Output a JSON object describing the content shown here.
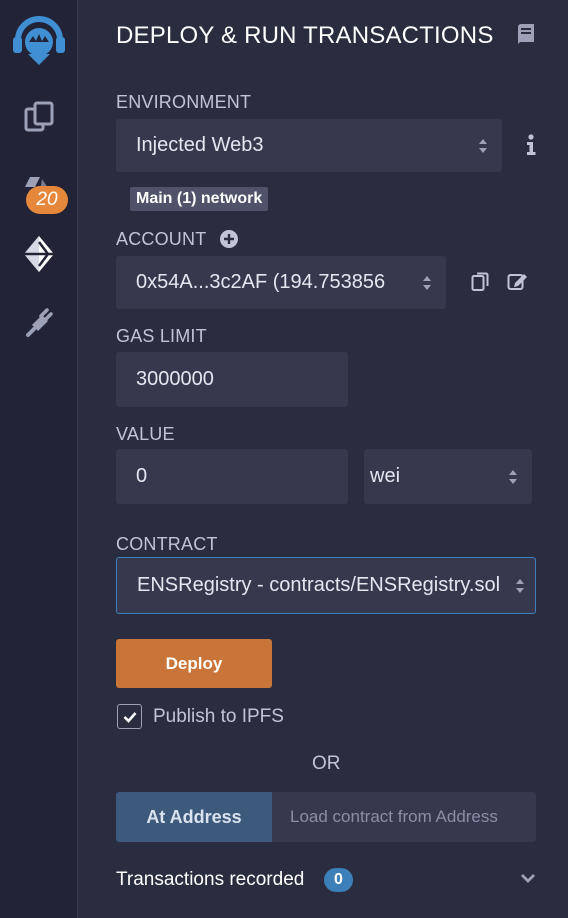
{
  "sidebar": {
    "icons": [
      "remix-logo-icon",
      "files-icon",
      "solidity-compiler-icon",
      "deploy-run-icon",
      "plugin-manager-icon"
    ],
    "compiler_badge": "20"
  },
  "header": {
    "title": "DEPLOY & RUN TRANSACTIONS"
  },
  "environment": {
    "label": "ENVIRONMENT",
    "selected": "Injected Web3",
    "network_tag": "Main (1) network"
  },
  "account": {
    "label": "ACCOUNT",
    "selected": "0x54A...3c2AF (194.753856"
  },
  "gas_limit": {
    "label": "GAS LIMIT",
    "value": "3000000"
  },
  "value": {
    "label": "VALUE",
    "amount": "0",
    "unit": "wei"
  },
  "contract": {
    "label": "CONTRACT",
    "selected": "ENSRegistry - contracts/ENSRegistry.sol"
  },
  "actions": {
    "deploy_label": "Deploy",
    "publish_ipfs_label": "Publish to IPFS",
    "publish_ipfs_checked": true,
    "or_label": "OR",
    "at_address_label": "At Address",
    "load_address_placeholder": "Load contract from Address"
  },
  "transactions": {
    "label": "Transactions recorded",
    "count": "0"
  },
  "colors": {
    "accent_blue": "#3d7fb8",
    "deploy_orange": "#c97539",
    "badge_orange": "#e6883c",
    "panel_bg": "#2a2c3f",
    "iconbar_bg": "#222336"
  }
}
